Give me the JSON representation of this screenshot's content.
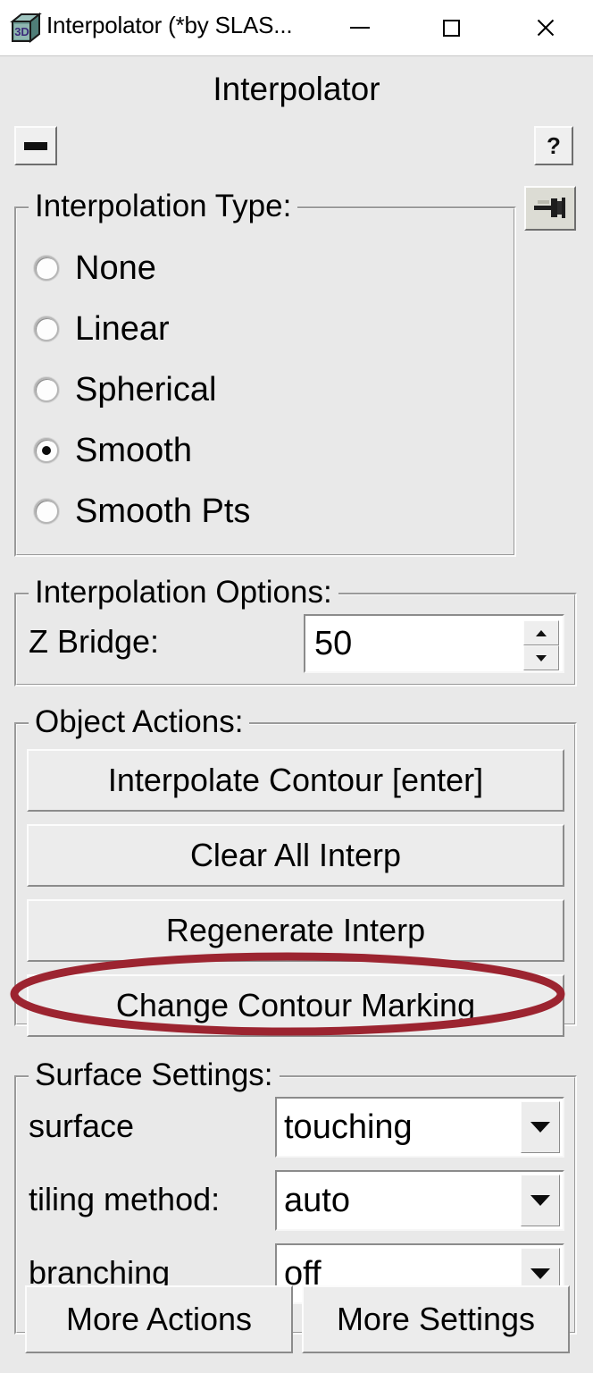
{
  "window": {
    "title": "Interpolator (*by SLAS...",
    "icon": "cube-3d-icon",
    "controls": {
      "minimize": "minimize-icon",
      "maximize": "maximize-icon",
      "close": "close-icon"
    }
  },
  "panel": {
    "title": "Interpolator",
    "collapse_label": "",
    "help_label": "?",
    "pin_label": "pin-icon"
  },
  "interpolation_type": {
    "legend": "Interpolation Type:",
    "selected": "Smooth",
    "options": [
      {
        "label": "None",
        "checked": false
      },
      {
        "label": "Linear",
        "checked": false
      },
      {
        "label": "Spherical",
        "checked": false
      },
      {
        "label": "Smooth",
        "checked": true
      },
      {
        "label": "Smooth Pts",
        "checked": false
      }
    ]
  },
  "interpolation_options": {
    "legend": "Interpolation Options:",
    "z_bridge": {
      "label": "Z Bridge:",
      "value": "50"
    }
  },
  "object_actions": {
    "legend": "Object Actions:",
    "buttons": [
      {
        "label": "Interpolate Contour [enter]"
      },
      {
        "label": "Clear All Interp"
      },
      {
        "label": "Regenerate Interp"
      },
      {
        "label": "Change Contour Marking",
        "highlighted": true
      }
    ]
  },
  "surface_settings": {
    "legend": "Surface Settings:",
    "rows": [
      {
        "label": "surface",
        "value": "touching"
      },
      {
        "label": "tiling method:",
        "value": "auto"
      },
      {
        "label": "branching",
        "value": "off"
      }
    ]
  },
  "footer": {
    "buttons": [
      {
        "label": "More Actions"
      },
      {
        "label": "More Settings"
      }
    ]
  },
  "annotation": {
    "type": "ellipse-highlight",
    "target": "Change Contour Marking",
    "color": "#9c2430"
  }
}
